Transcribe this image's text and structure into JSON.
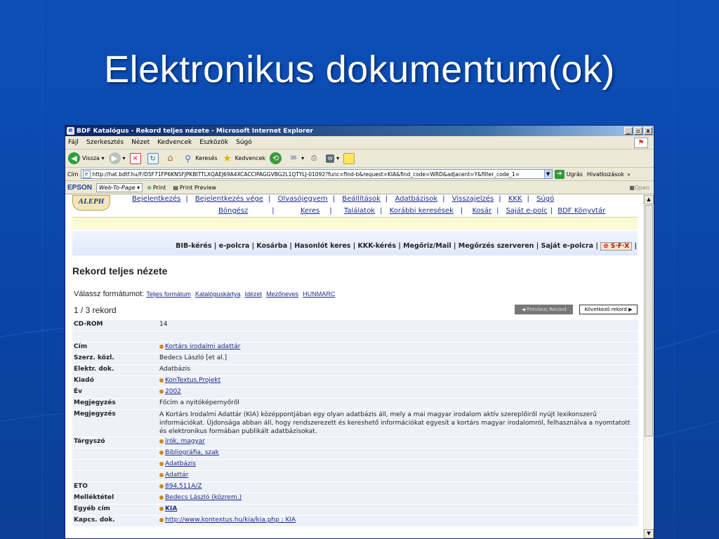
{
  "slide": {
    "title": "Elektronikus dokumentum(ok)"
  },
  "window": {
    "title": "BDF Katalógus - Rekord teljes nézete - Microsoft Internet Explorer",
    "controls": [
      "_",
      "²",
      "x"
    ]
  },
  "menu": [
    "Fájl",
    "Szerkesztés",
    "Nézet",
    "Kedvencek",
    "Eszközök",
    "Súgó"
  ],
  "toolbar": {
    "back": "Vissza",
    "search": "Keresés",
    "favorites": "Kedvencek"
  },
  "address": {
    "label": "Cím",
    "url": "http://hat.bdtf.hu/F/D5F71FP6KN5FJPKBITTLXQAEJ69A4XCACCIPAGGVBG2L1QTYLJ-01092?func=find-b&request=KIA&find_code=WRD&adjacent=Y&filter_code_1=",
    "go": "Ugrás",
    "links": "Hivatkozások"
  },
  "epson": {
    "brand": "EPSON",
    "web_to_page": "Web-To-Page",
    "print": "Print",
    "print_preview": "Print Preview",
    "open": "Open"
  },
  "nav_top": [
    "Bejelentkezés",
    "Bejelentkezés vége",
    "Olvasójegyem",
    "Beállítások",
    "Adatbázisok",
    "Visszajelzés",
    "KKK",
    "Súgó"
  ],
  "nav_second": [
    "Böngész",
    "Keres",
    "Találatok",
    "Korábbi keresések",
    "Kosár",
    "Saját e-polc",
    "BDF Könyvtár"
  ],
  "logo": "ALEPH",
  "bib_links": [
    "BIB-kérés",
    "e-polcra",
    "Kosárba",
    "Hasonlót keres",
    "KKK-kérés",
    "Megőriz/Mail",
    "Megőrzés szerveren",
    "Saját e-polcra"
  ],
  "sfx": "S·F·X",
  "heading": "Rekord teljes nézete",
  "format": {
    "label": "Válassz formátumot:",
    "options": [
      "Teljes formátum",
      "Katalóguskártya",
      "Idézet",
      "Mezőneves",
      "HUNMARC"
    ]
  },
  "record_counter": "1 / 3 rekord",
  "prev_button": "Previous Record",
  "next_button": "Következő rekord",
  "record_rows": [
    {
      "label": "CD-ROM",
      "value": "14",
      "link": false
    },
    {
      "label": "",
      "value": "",
      "link": false
    },
    {
      "label": "Cím",
      "value": "Kortárs irodalmi adattár",
      "link": true
    },
    {
      "label": "Szerz. közl.",
      "value": "Bedecs László [et al.]",
      "link": false
    },
    {
      "label": "Elektr. dok.",
      "value": "Adatbázis",
      "link": false
    },
    {
      "label": "Kiadó",
      "value": "KonTextus.Projekt",
      "link": true
    },
    {
      "label": "Év",
      "value": "2002",
      "link": true
    },
    {
      "label": "Megjegyzés",
      "value": "Főcím a nyitóképernyőről",
      "link": false
    },
    {
      "label": "Megjegyzés",
      "value": "A Kortárs Irodalmi Adattár (KIA) középpontjában egy olyan adatbázis áll, mely a mai magyar irodalom aktív szereplőiről nyújt lexikonszerű információkat. Újdonsága abban áll, hogy rendszerezett és kereshető információkat egyesít a kortárs magyar irodalomról, felhasználva a nyomtatott és elektronikus formában publikált adatbázisokat.",
      "link": false
    },
    {
      "label": "Tárgyszó",
      "value": "írók, magyar",
      "link": true
    },
    {
      "label": "",
      "value": "Bibliográfia, szak",
      "link": true
    },
    {
      "label": "",
      "value": "Adatbázis",
      "link": true
    },
    {
      "label": "",
      "value": "Adattár",
      "link": true
    },
    {
      "label": "ETO",
      "value": "894.511A/Z",
      "link": true
    },
    {
      "label": "Melléktétel",
      "value": "Bedecs László (közrem.)",
      "link": true
    },
    {
      "label": "Egyéb cím",
      "value": "KIA",
      "link": true
    },
    {
      "label": "Kapcs. dok.",
      "value": "http://www.kontextus.hu/kia/kia.php ; KIA",
      "link": true
    }
  ]
}
